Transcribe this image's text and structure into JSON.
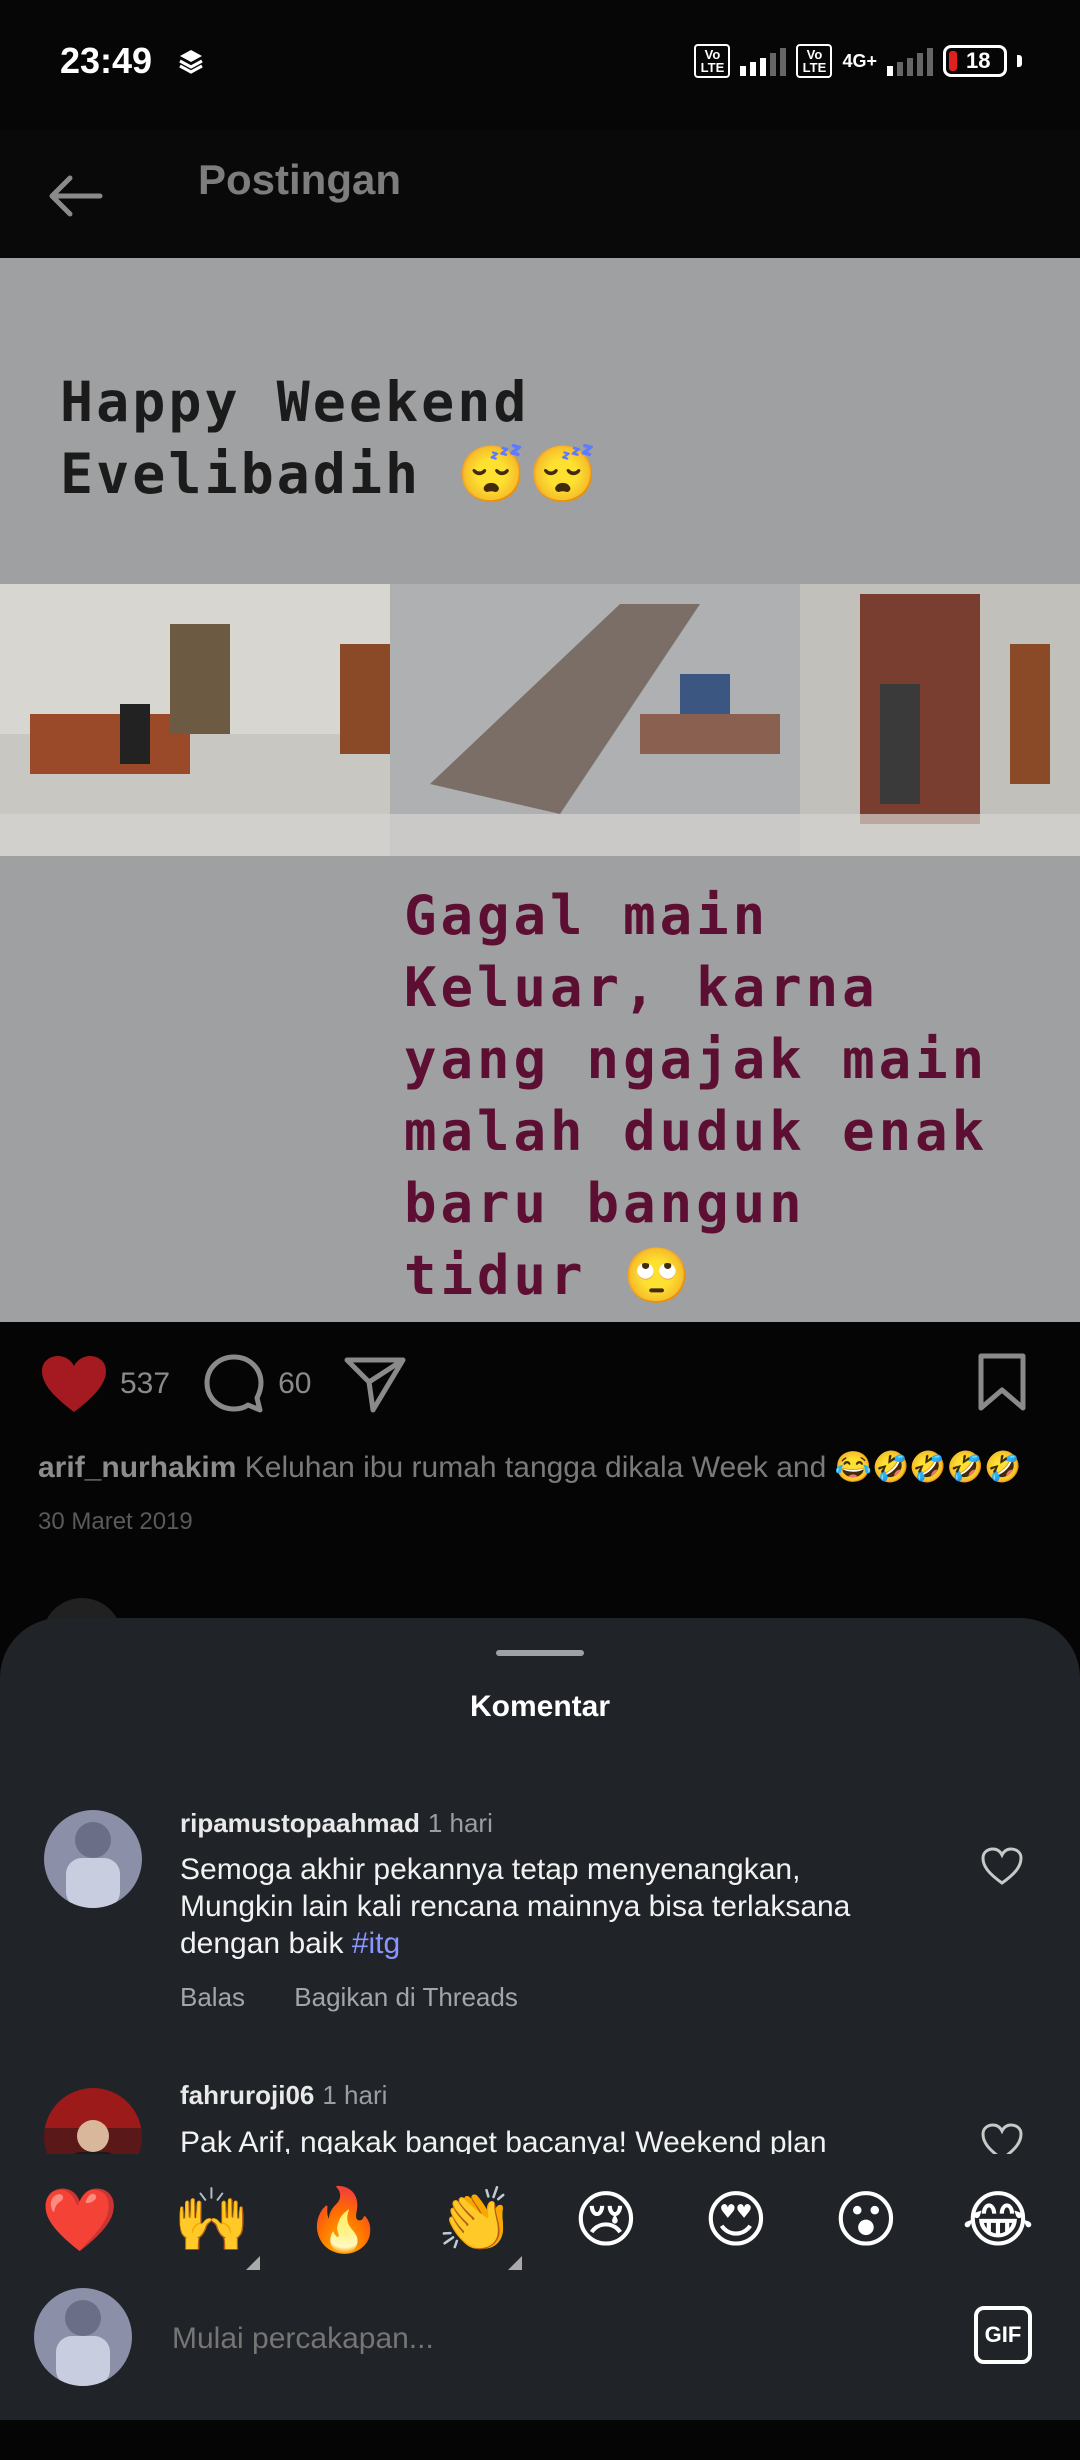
{
  "status_bar": {
    "time": "23:49",
    "volte1": "Vo LTE",
    "volte2": "Vo LTE",
    "network": "4G+",
    "battery": "18"
  },
  "header": {
    "title": "Postingan",
    "back_icon": "arrow-left-icon"
  },
  "post": {
    "image_text_top": [
      "Happy Weekend",
      "Evelibadih 😴😴"
    ],
    "image_text_bottom": [
      "Gagal main",
      "Keluar, karna",
      "yang ngajak main",
      "malah duduk enak",
      "baru bangun",
      "tidur 🙄"
    ],
    "likes": "537",
    "comments": "60",
    "caption_user": "arif_nurhakim",
    "caption_text": "Keluhan ibu rumah tangga dikala Week and 😂🤣🤣🤣🤣",
    "date": "30 Maret 2019",
    "icons": [
      "heart-filled-icon",
      "comment-icon",
      "share-icon",
      "bookmark-icon"
    ],
    "like_color": "#e0242c"
  },
  "comments_sheet": {
    "title": "Komentar",
    "comments": [
      {
        "user": "ripamustopaahmad",
        "time": "1 hari",
        "text_lines": [
          "Semoga akhir pekannya tetap menyenangkan,",
          "Mungkin lain kali rencana mainnya bisa terlaksana",
          "dengan baik"
        ],
        "hashtag": "#itg",
        "reply_label": "Balas",
        "share_label": "Bagikan di Threads"
      },
      {
        "user": "fahruroji06",
        "time": "1 hari",
        "text_lines": [
          "Pak Arif, ngakak banget bacanya! Weekend plan"
        ]
      }
    ]
  },
  "emoji_bar": [
    "❤️",
    "🙌",
    "🔥",
    "👏",
    "😢",
    "😍",
    "😮",
    "😂"
  ],
  "composer": {
    "placeholder": "Mulai percakapan...",
    "gif_label": "GIF"
  }
}
